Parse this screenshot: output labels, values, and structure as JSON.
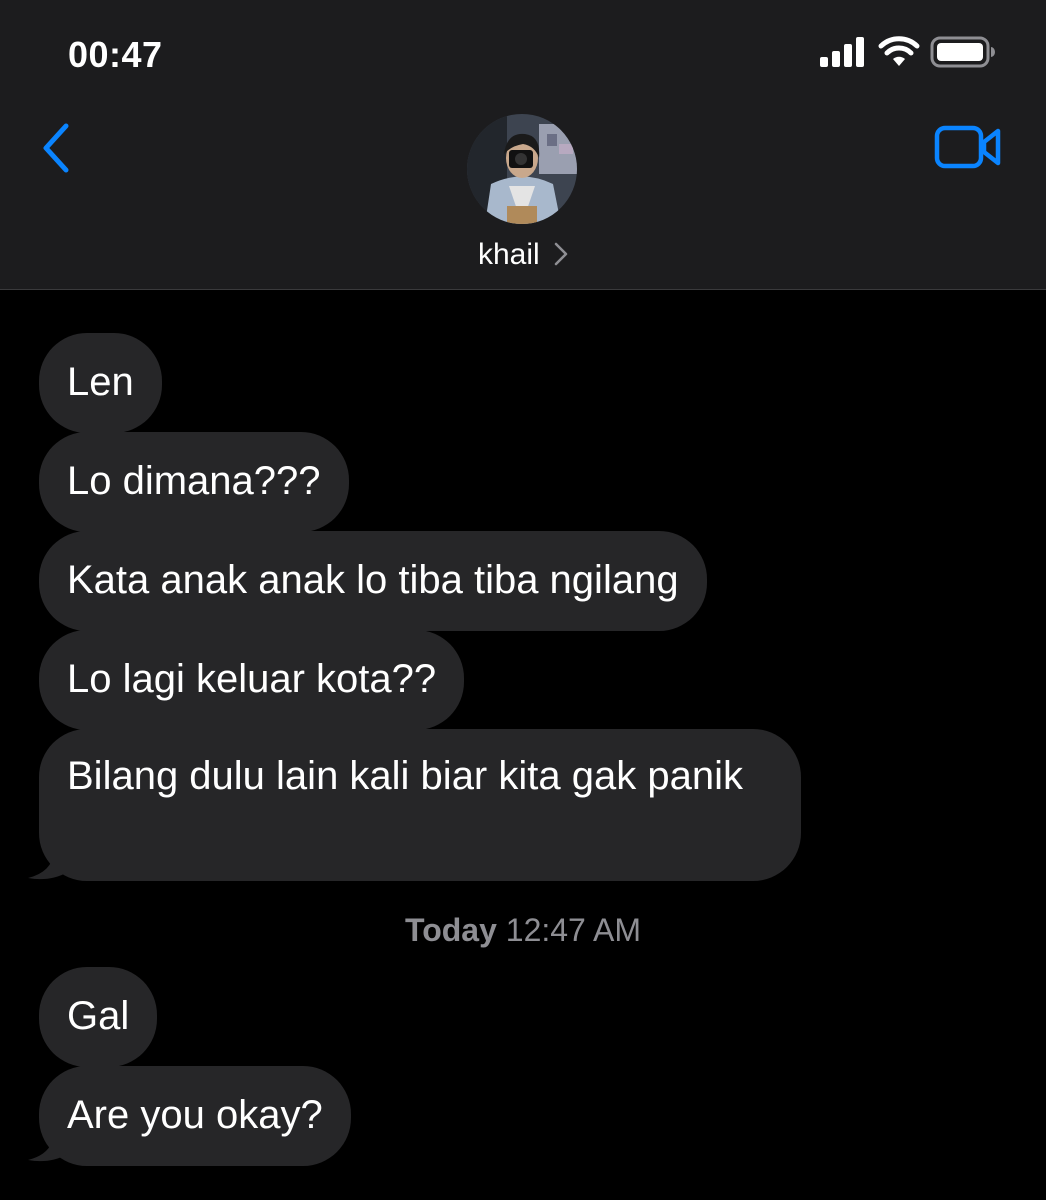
{
  "status_bar": {
    "time": "00:47",
    "icons": [
      "cellular-signal-icon",
      "wifi-icon",
      "battery-icon"
    ]
  },
  "nav": {
    "back_icon": "chevron-left-icon",
    "video_icon": "video-camera-icon",
    "contact_name": "khail",
    "accent_color": "#0a84ff"
  },
  "messages": [
    {
      "text": "Len"
    },
    {
      "text": "Lo dimana???"
    },
    {
      "text": "Kata anak anak lo tiba tiba ngilang"
    },
    {
      "text": "Lo lagi keluar kota??"
    },
    {
      "text": "Bilang dulu lain kali biar kita gak panik"
    },
    {
      "text": "Gal"
    },
    {
      "text": "Are you okay?"
    }
  ],
  "timestamp": {
    "day": "Today",
    "time": "12:47 AM"
  },
  "colors": {
    "background": "#000000",
    "header": "#1c1c1e",
    "bubble": "#262628",
    "timestamp_text": "#8e8e93"
  }
}
